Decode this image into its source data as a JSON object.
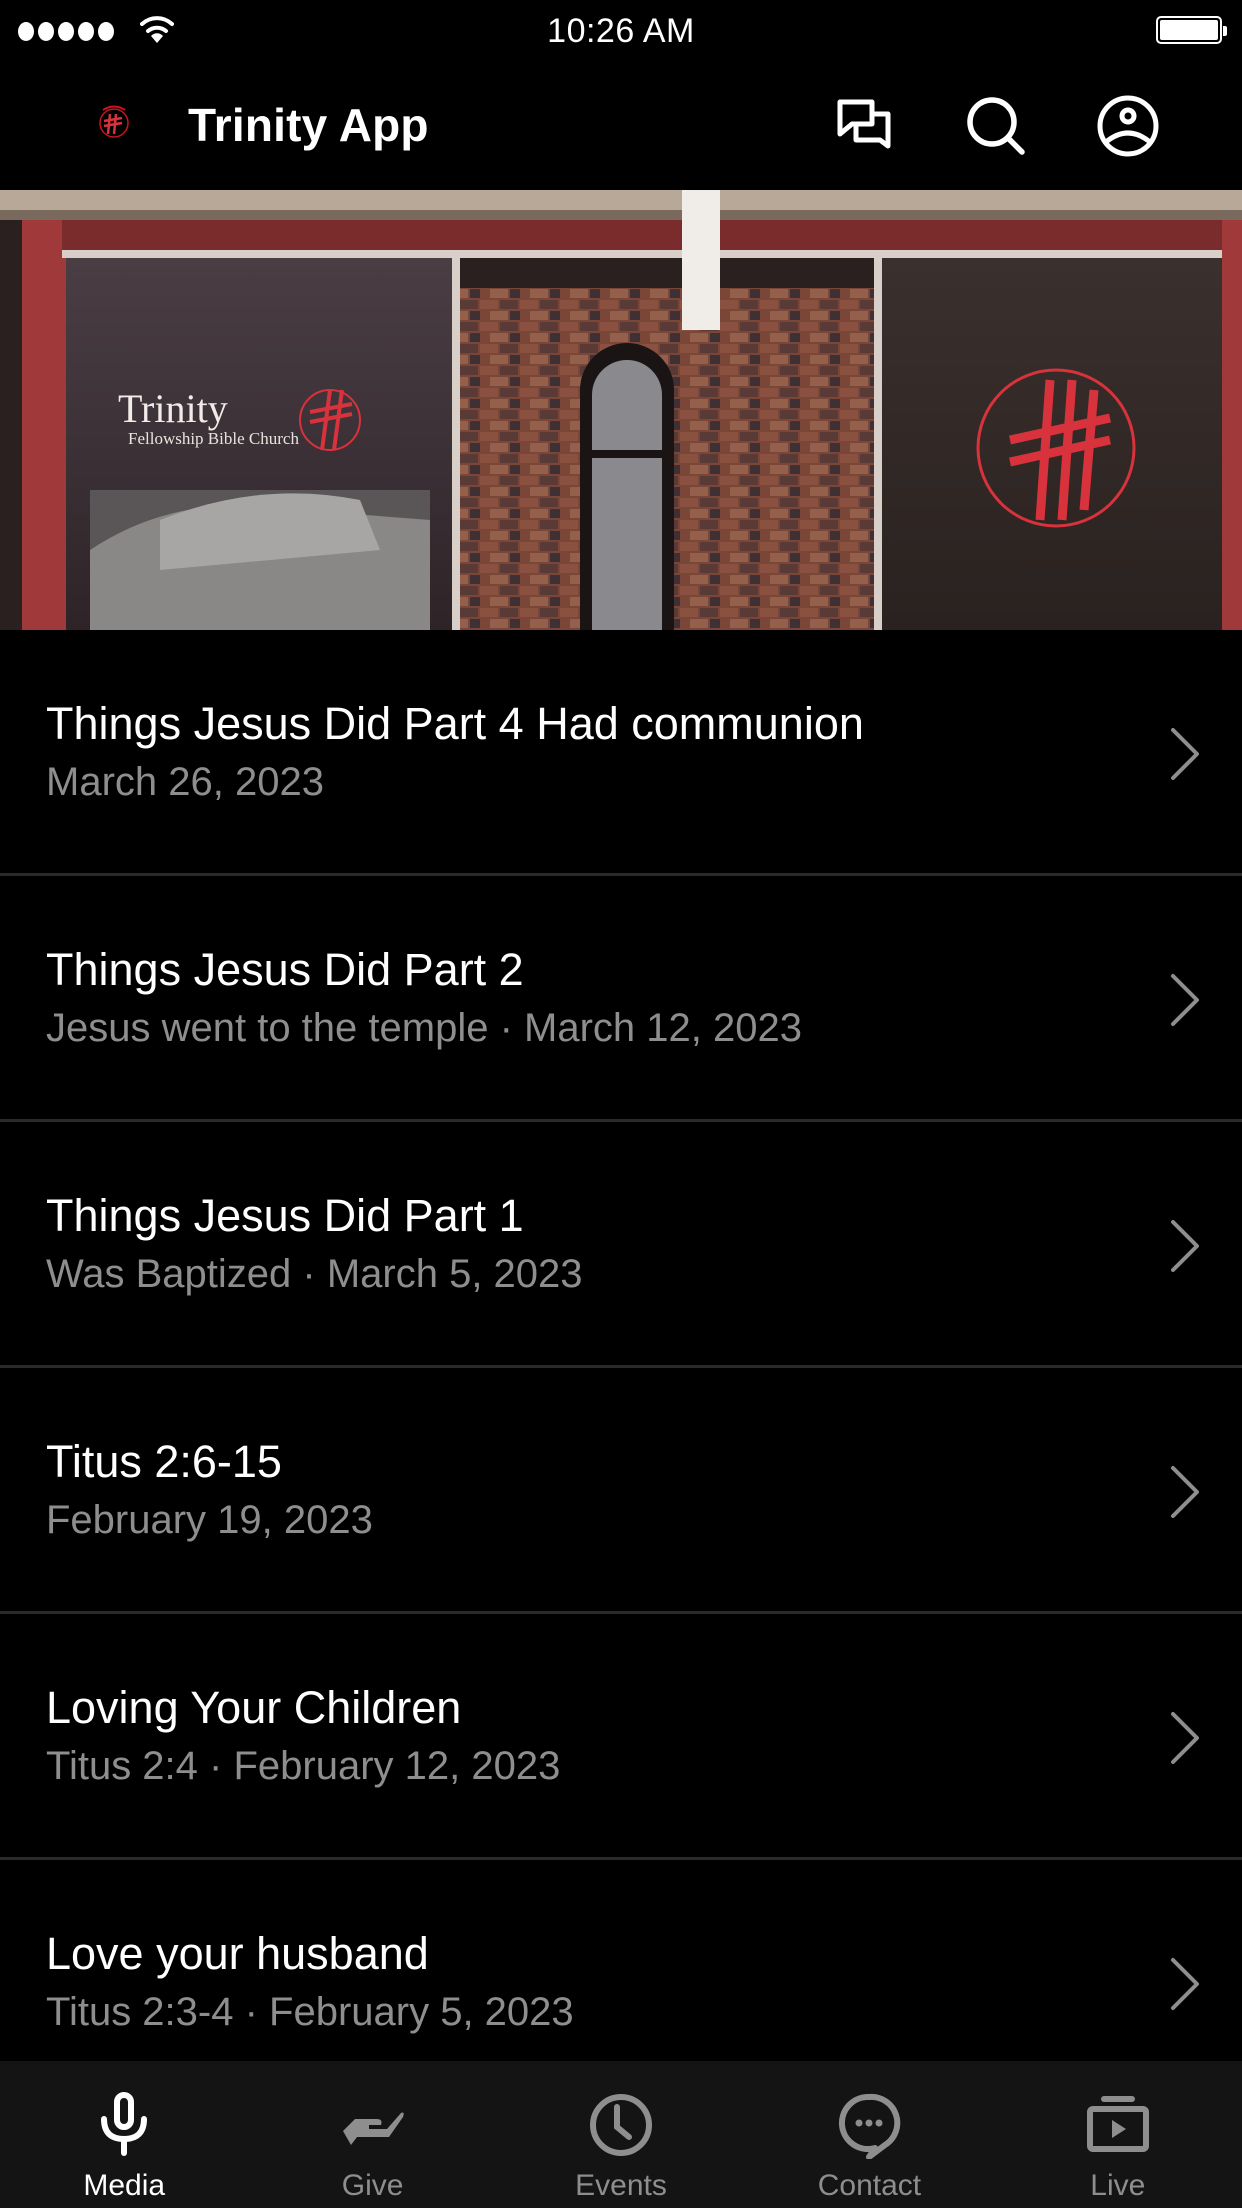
{
  "status_bar": {
    "time": "10:26 AM",
    "signal_bars": 5,
    "battery_level": 1.0
  },
  "header": {
    "title": "Trinity App",
    "icons": [
      "chat-icon",
      "search-icon",
      "profile-icon"
    ]
  },
  "hero": {
    "sign_title": "Trinity",
    "sign_subtitle": "Fellowship Bible Church"
  },
  "sermons": [
    {
      "title": "Things Jesus Did Part 4 Had communion",
      "subtitle": "March 26, 2023"
    },
    {
      "title": "Things Jesus Did Part 2",
      "subtitle": "Jesus went to the temple · March 12, 2023"
    },
    {
      "title": "Things Jesus Did Part 1",
      "subtitle": "Was Baptized · March 5, 2023"
    },
    {
      "title": "Titus 2:6-15",
      "subtitle": "February 19, 2023"
    },
    {
      "title": "Loving Your Children",
      "subtitle": "Titus 2:4 · February 12, 2023"
    },
    {
      "title": "Love your husband",
      "subtitle": "Titus 2:3-4 · February 5, 2023"
    }
  ],
  "tabs": [
    {
      "label": "Media",
      "icon": "microphone-icon",
      "active": true
    },
    {
      "label": "Give",
      "icon": "giving-hand-icon",
      "active": false
    },
    {
      "label": "Events",
      "icon": "clock-icon",
      "active": false
    },
    {
      "label": "Contact",
      "icon": "speech-bubble-icon",
      "active": false
    },
    {
      "label": "Live",
      "icon": "video-playlist-icon",
      "active": false
    }
  ],
  "colors": {
    "background": "#000000",
    "tab_bar": "#141414",
    "separator": "#2a2a2a",
    "secondary_text": "#8e8e8e",
    "active_tab": "#ffffff",
    "inactive_tab": "#8e8e8e",
    "brand_red": "#d8323c"
  }
}
